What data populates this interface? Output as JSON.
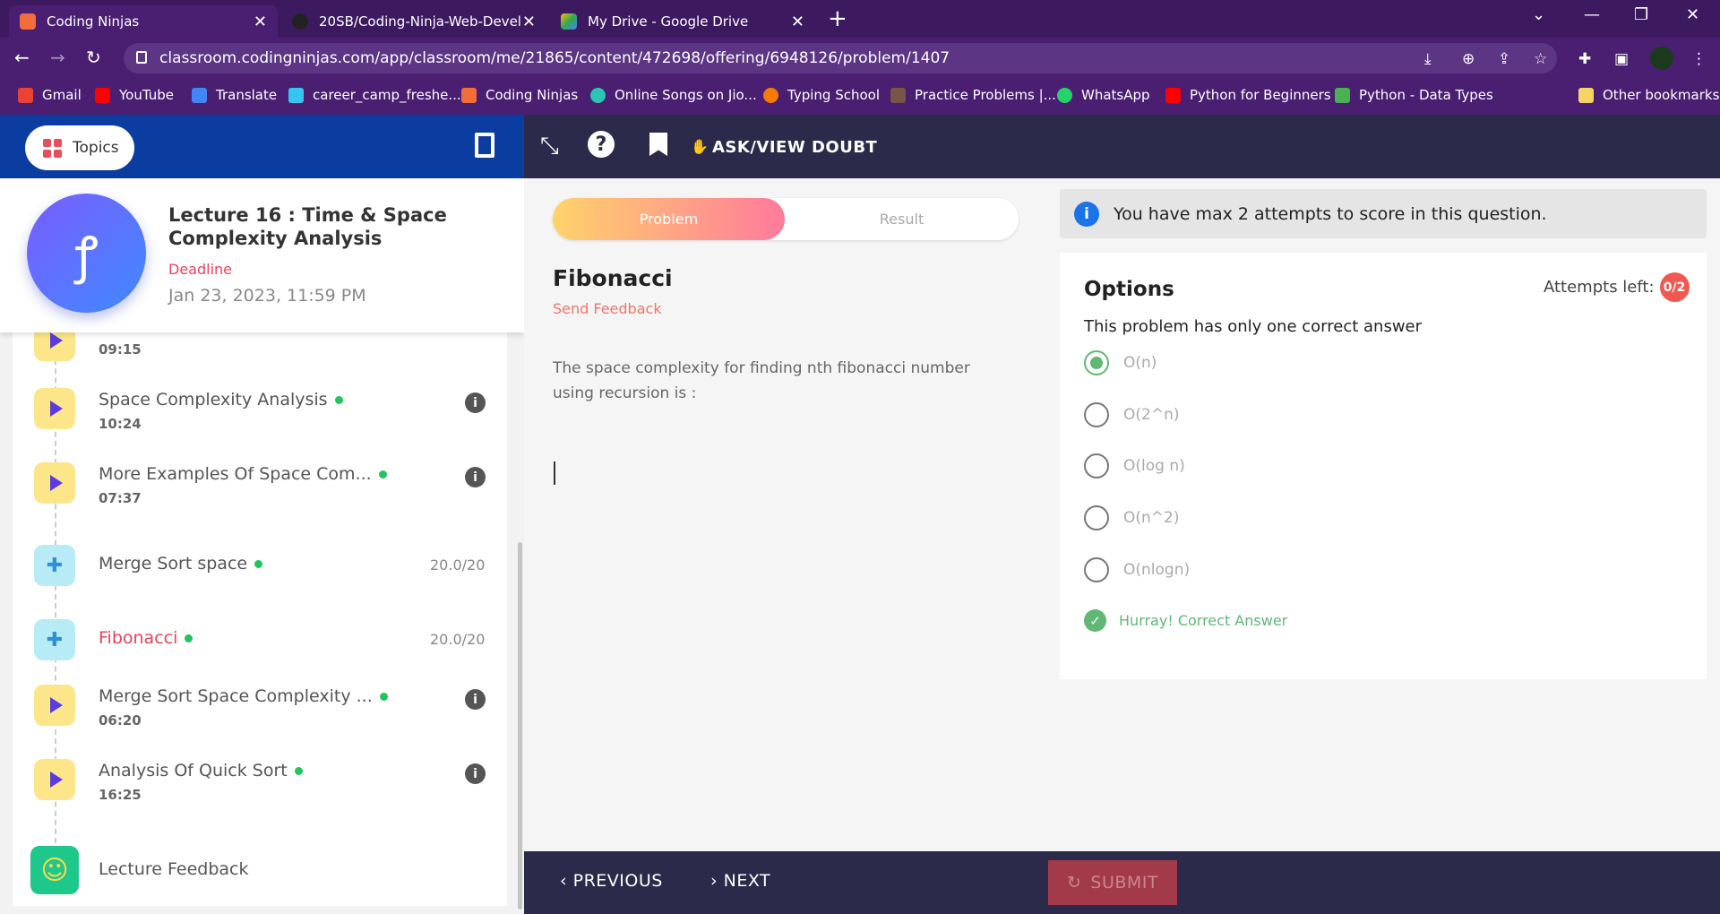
{
  "browser": {
    "tabs": [
      {
        "title": "Coding Ninjas",
        "color": "#f36d3b"
      },
      {
        "title": "20SB/Coding-Ninja-Web-Develop",
        "color": "#222222"
      },
      {
        "title": "My Drive - Google Drive",
        "color": "#fbbc04"
      }
    ],
    "url": "classroom.codingninjas.com/app/classroom/me/21865/content/472698/offering/6948126/problem/1407",
    "bookmarks": [
      {
        "label": "Gmail",
        "color": "#ea4335"
      },
      {
        "label": "YouTube",
        "color": "#ff0000"
      },
      {
        "label": "Translate",
        "color": "#4285f4"
      },
      {
        "label": "career_camp_freshe...",
        "color": "#36c5f0"
      },
      {
        "label": "Coding Ninjas",
        "color": "#f36d3b"
      },
      {
        "label": "Online Songs on Jio...",
        "color": "#2bc5b4"
      },
      {
        "label": "Typing School",
        "color": "#f57c00"
      },
      {
        "label": "Practice Problems |...",
        "color": "#795548"
      },
      {
        "label": "WhatsApp",
        "color": "#25d366"
      },
      {
        "label": "Python for Beginners",
        "color": "#ff0000"
      },
      {
        "label": "Python - Data Types",
        "color": "#4caf50"
      }
    ],
    "other_bookmarks": "Other bookmarks"
  },
  "sidebar": {
    "topics_label": "Topics",
    "lecture_title": "Lecture 16 : Time & Space Complexity Analysis",
    "deadline_label": "Deadline",
    "deadline_date": "Jan 23, 2023, 11:59 PM",
    "items": [
      {
        "name": "",
        "duration": "09:15"
      },
      {
        "name": "Space Complexity Analysis",
        "duration": "10:24"
      },
      {
        "name": "More Examples Of Space Com...",
        "duration": "07:37"
      },
      {
        "name": "Merge Sort space",
        "score": "20.0/20"
      },
      {
        "name": "Fibonacci",
        "score": "20.0/20"
      },
      {
        "name": "Merge Sort Space Complexity ...",
        "duration": "06:20"
      },
      {
        "name": "Analysis Of Quick Sort",
        "duration": "16:25"
      },
      {
        "name": "Lecture Feedback"
      }
    ]
  },
  "toolbar": {
    "ask_label": "ASK/VIEW DOUBT"
  },
  "problem": {
    "tab_problem": "Problem",
    "tab_result": "Result",
    "title": "Fibonacci",
    "feedback": "Send Feedback",
    "description": "The space complexity for finding nth fibonacci number using recursion is :"
  },
  "answer": {
    "notice": "You have max 2 attempts to score in this question.",
    "options_title": "Options",
    "attempts_label": "Attempts left:",
    "attempts_value": "0/2",
    "info": "This problem has only one correct answer",
    "options": [
      "O(n)",
      "O(2^n)",
      "O(log n)",
      "O(n^2)",
      "O(nlogn)"
    ],
    "selected_index": 0,
    "result": "Hurray! Correct Answer"
  },
  "footer": {
    "previous": "PREVIOUS",
    "next": "NEXT",
    "submit": "SUBMIT"
  }
}
